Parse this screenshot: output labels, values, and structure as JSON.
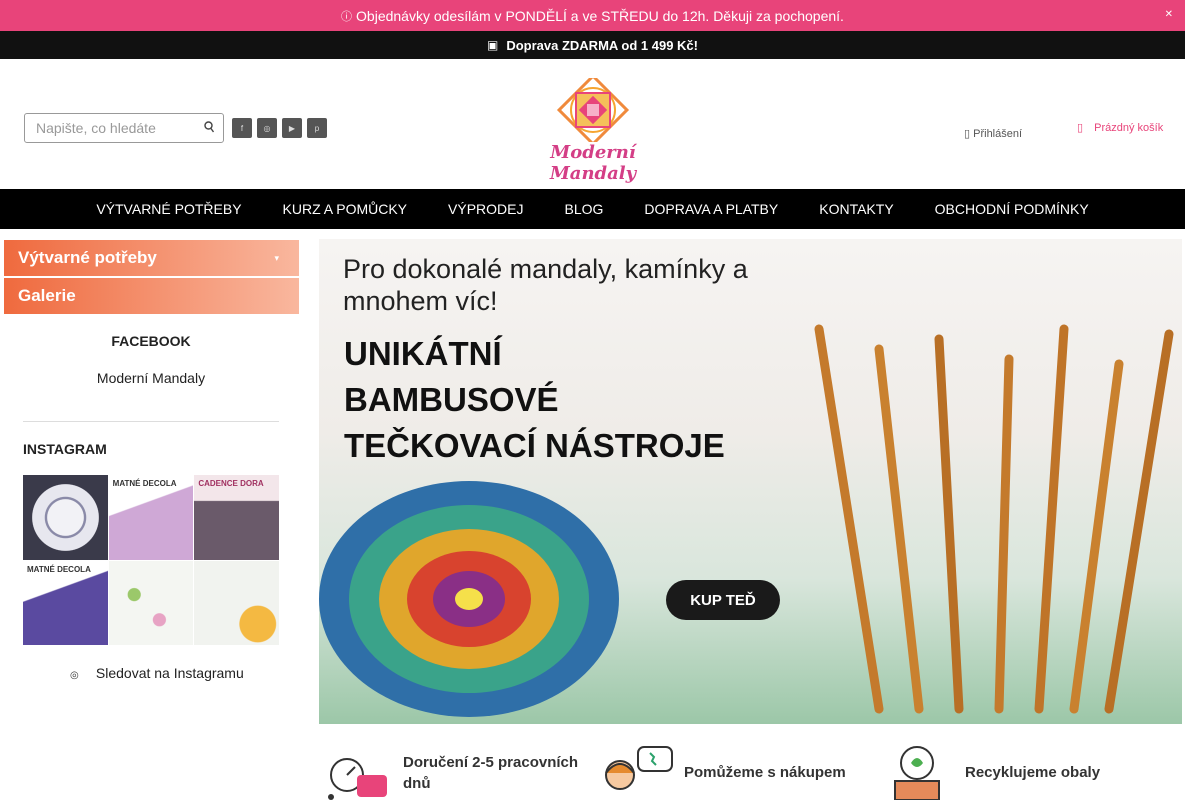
{
  "notice": {
    "icon": "info-icon",
    "text": "Objednávky odesílám v PONDĚLÍ a ve STŘEDU do 12h. Děkuji za pochopení.",
    "close_icon": "close-icon"
  },
  "shipping": {
    "icon": "truck-icon",
    "text": "Doprava ZDARMA od 1 499 Kč!"
  },
  "header": {
    "search_placeholder": "Napište, co hledáte",
    "socials": [
      "facebook-icon",
      "instagram-icon",
      "youtube-icon",
      "pinterest-icon"
    ],
    "logo_text": "Moderní Mandaly",
    "login": "Přihlášení",
    "cart": "Prázdný košík"
  },
  "nav": [
    "VÝTVARNÉ POTŘEBY",
    "KURZ A POMŮCKY",
    "VÝPRODEJ",
    "BLOG",
    "DOPRAVA A PLATBY",
    "KONTAKTY",
    "OBCHODNÍ PODMÍNKY"
  ],
  "sidebar": {
    "categories": [
      "Výtvarné potřeby",
      "Galerie"
    ],
    "facebook_title": "FACEBOOK",
    "facebook_link": "Moderní Mandaly",
    "instagram_title": "INSTAGRAM",
    "instagram_posts": [
      {
        "caption": "",
        "color": "#3a3a4a"
      },
      {
        "caption": "MATNÉ DECOLA",
        "color": "#b58fb5"
      },
      {
        "caption": "CADENCE DORA",
        "color": "#6a5a6a"
      },
      {
        "caption": "MATNÉ DECOLA",
        "color": "#5a4aa0"
      },
      {
        "caption": "",
        "color": "#e9eef0"
      },
      {
        "caption": "",
        "color": "#cfd9d0"
      }
    ],
    "follow": "Sledovat na Instagramu"
  },
  "banner": {
    "headline": "Pro dokonalé mandaly, kamínky a mnohem víc!",
    "headline_l1": "Pro dokonalé mandaly, kamínky a",
    "headline_l2": "mnohem víc!",
    "product_l1": "UNIKÁTNÍ",
    "product_l2": "BAMBUSOVÉ",
    "product_l3": "TEČKOVACÍ NÁSTROJE",
    "cta": "KUP TEĎ"
  },
  "features": [
    {
      "icon": "delivery-scooter-icon",
      "l1": "Doručení 2-5 pracovních",
      "l2": "dnů"
    },
    {
      "icon": "support-agent-icon",
      "l1": "Pomůžeme s nákupem",
      "l2": ""
    },
    {
      "icon": "recycle-box-icon",
      "l1": "Recyklujeme obaly",
      "l2": ""
    }
  ]
}
